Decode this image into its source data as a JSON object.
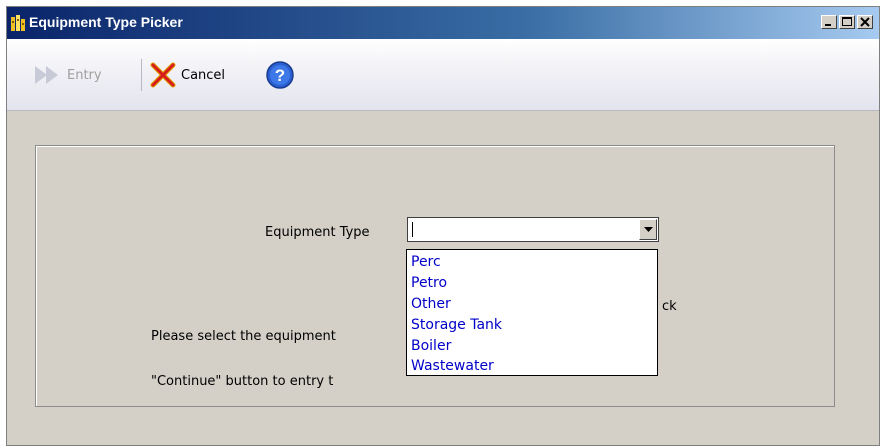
{
  "window": {
    "title": "Equipment Type Picker",
    "app_icon": "building-icon"
  },
  "toolbar": {
    "entry_label": "Entry",
    "cancel_label": "Cancel",
    "entry_icon": "double-arrow-right-icon",
    "cancel_icon": "red-x-icon",
    "help_icon": "help-icon"
  },
  "form": {
    "equipment_type_label": "Equipment Type",
    "equipment_type_value": "",
    "message_line1_left": "Please select the equipment",
    "message_line1_right": "ck",
    "message_line2_left": "\"Continue\" button to entry t",
    "message_line2_right": ""
  },
  "dropdown": {
    "options": [
      "Perc",
      "Petro",
      "Other",
      "Storage Tank",
      "Boiler",
      "Wastewater"
    ]
  },
  "colors": {
    "titlebar_start": "#0a246a",
    "dialog_bg": "#d4d0c8",
    "option_text": "#0000c8",
    "cancel_x": "#e0a000"
  }
}
